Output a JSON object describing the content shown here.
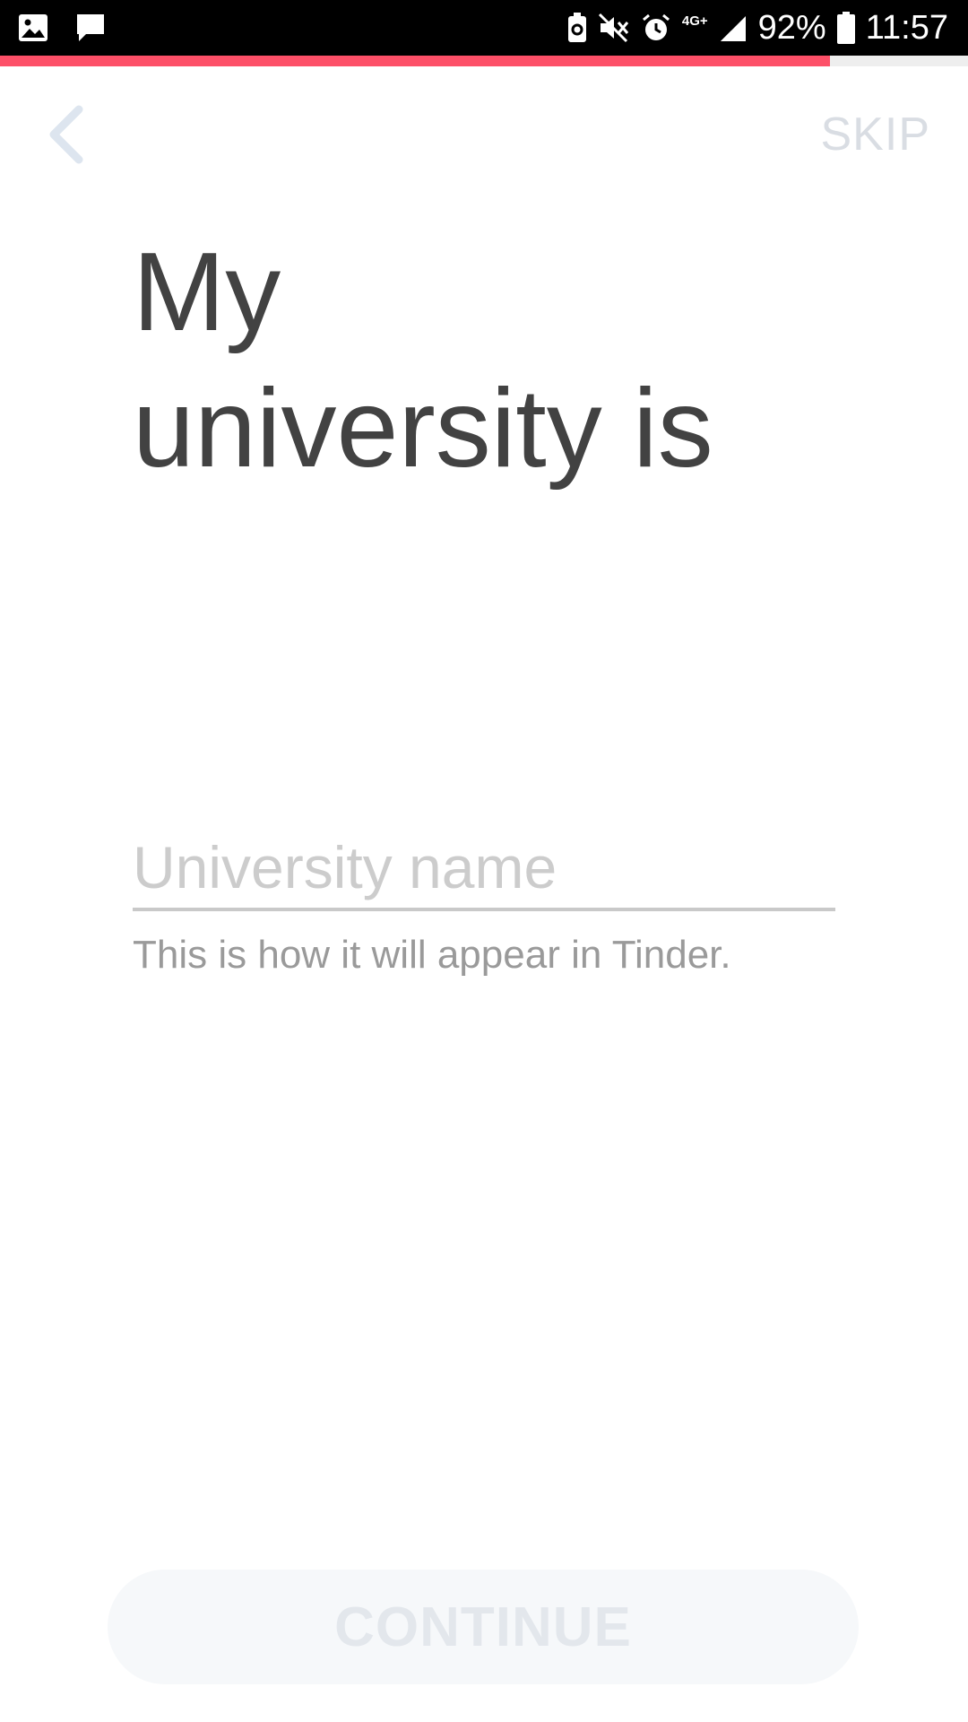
{
  "status_bar": {
    "network": "4G+",
    "battery_percent": "92%",
    "time": "11:57",
    "icons": [
      "gallery-icon",
      "message-icon",
      "battery-saver-icon",
      "mute-icon",
      "alarm-icon",
      "network-icon",
      "signal-icon",
      "battery-icon"
    ]
  },
  "progress": {
    "fraction": 0.857,
    "color": "#fd5068"
  },
  "nav": {
    "back_icon": "chevron-left-icon",
    "skip_label": "SKIP"
  },
  "title": {
    "line1": "My",
    "line2": "university is"
  },
  "form": {
    "university_placeholder": "University name",
    "university_value": "",
    "helper_text": "This is how it will appear in Tinder."
  },
  "footer": {
    "continue_label": "CONTINUE"
  },
  "colors": {
    "accent": "#fd5068",
    "title_text": "#424242",
    "muted_text": "#9a9a9a",
    "disabled_text": "#e3e7ec"
  }
}
